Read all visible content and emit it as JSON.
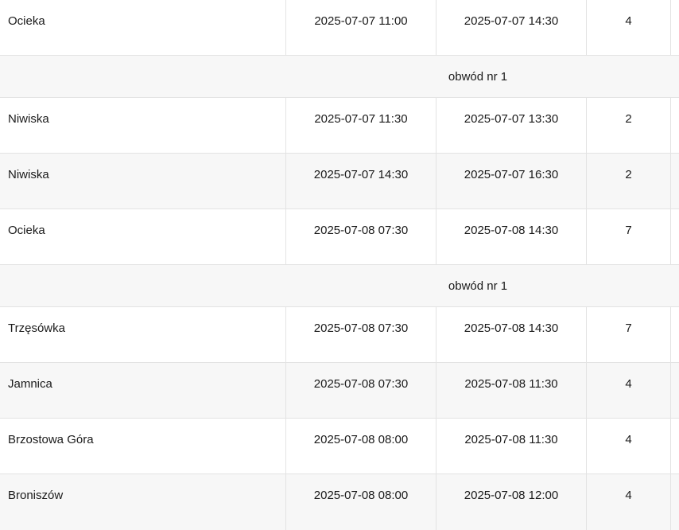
{
  "rows": [
    {
      "type": "data",
      "name": "Ocieka",
      "start": "2025-07-07 11:00",
      "end": "2025-07-07 14:30",
      "count": "4"
    },
    {
      "type": "group",
      "label": "obwód nr 1"
    },
    {
      "type": "data",
      "name": "Niwiska",
      "start": "2025-07-07 11:30",
      "end": "2025-07-07 13:30",
      "count": "2"
    },
    {
      "type": "data",
      "name": "Niwiska",
      "start": "2025-07-07 14:30",
      "end": "2025-07-07 16:30",
      "count": "2"
    },
    {
      "type": "data",
      "name": "Ocieka",
      "start": "2025-07-08 07:30",
      "end": "2025-07-08 14:30",
      "count": "7"
    },
    {
      "type": "group",
      "label": "obwód nr 1"
    },
    {
      "type": "data",
      "name": "Trzęsówka",
      "start": "2025-07-08 07:30",
      "end": "2025-07-08 14:30",
      "count": "7"
    },
    {
      "type": "data",
      "name": "Jamnica",
      "start": "2025-07-08 07:30",
      "end": "2025-07-08 11:30",
      "count": "4"
    },
    {
      "type": "data",
      "name": "Brzostowa Góra",
      "start": "2025-07-08 08:00",
      "end": "2025-07-08 11:30",
      "count": "4"
    },
    {
      "type": "data",
      "name": "Broniszów",
      "start": "2025-07-08 08:00",
      "end": "2025-07-08 12:00",
      "count": "4"
    }
  ]
}
